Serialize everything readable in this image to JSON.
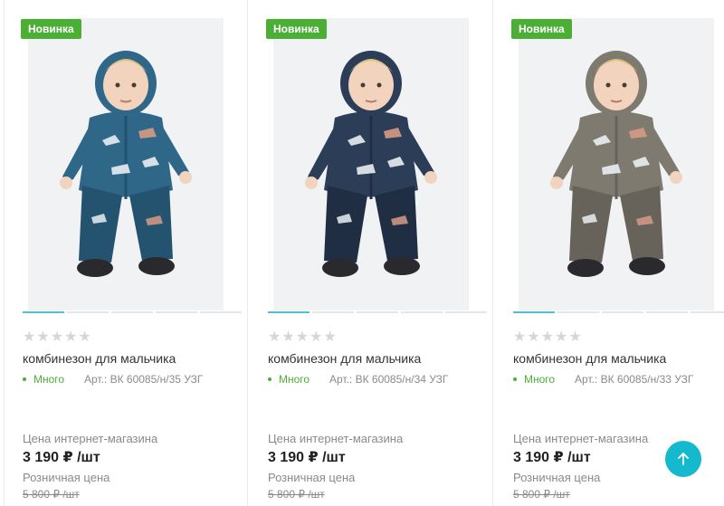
{
  "products": [
    {
      "badge": "Новинка",
      "title": "комбинезон для мальчика",
      "stars": "★★★★★",
      "stock": "Много",
      "article": "Арт.: ВК 60085/н/35 УЗГ",
      "price_label": "Цена интернет-магазина",
      "price": "3 190 ₽ /шт",
      "retail_label": "Розничная цена",
      "old_price": "5 800 ₽ /шт",
      "suit_color": "#2f6788",
      "suit_shade": "#24536f",
      "image_icon": "boy-in-dino-jumpsuit"
    },
    {
      "badge": "Новинка",
      "title": "комбинезон для мальчика",
      "stars": "★★★★★",
      "stock": "Много",
      "article": "Арт.: ВК 60085/н/34 УЗГ",
      "price_label": "Цена интернет-магазина",
      "price": "3 190 ₽ /шт",
      "retail_label": "Розничная цена",
      "old_price": "5 800 ₽ /шт",
      "suit_color": "#2c3e57",
      "suit_shade": "#1f2e43",
      "image_icon": "boy-in-dino-jumpsuit"
    },
    {
      "badge": "Новинка",
      "title": "комбинезон для мальчика",
      "stars": "★★★★★",
      "stock": "Много",
      "article": "Арт.: ВК 60085/н/33 УЗГ",
      "price_label": "Цена интернет-магазина",
      "price": "3 190 ₽ /шт",
      "retail_label": "Розничная цена",
      "old_price": "5 800 ₽ /шт",
      "suit_color": "#7f7a70",
      "suit_shade": "#67635a",
      "image_icon": "boy-in-dino-jumpsuit"
    }
  ],
  "colors": {
    "badge": "#4caf35",
    "accent": "#14b9cd",
    "slider_active": "#4fc3d3"
  },
  "scroll_top_icon": "arrow-up-icon"
}
